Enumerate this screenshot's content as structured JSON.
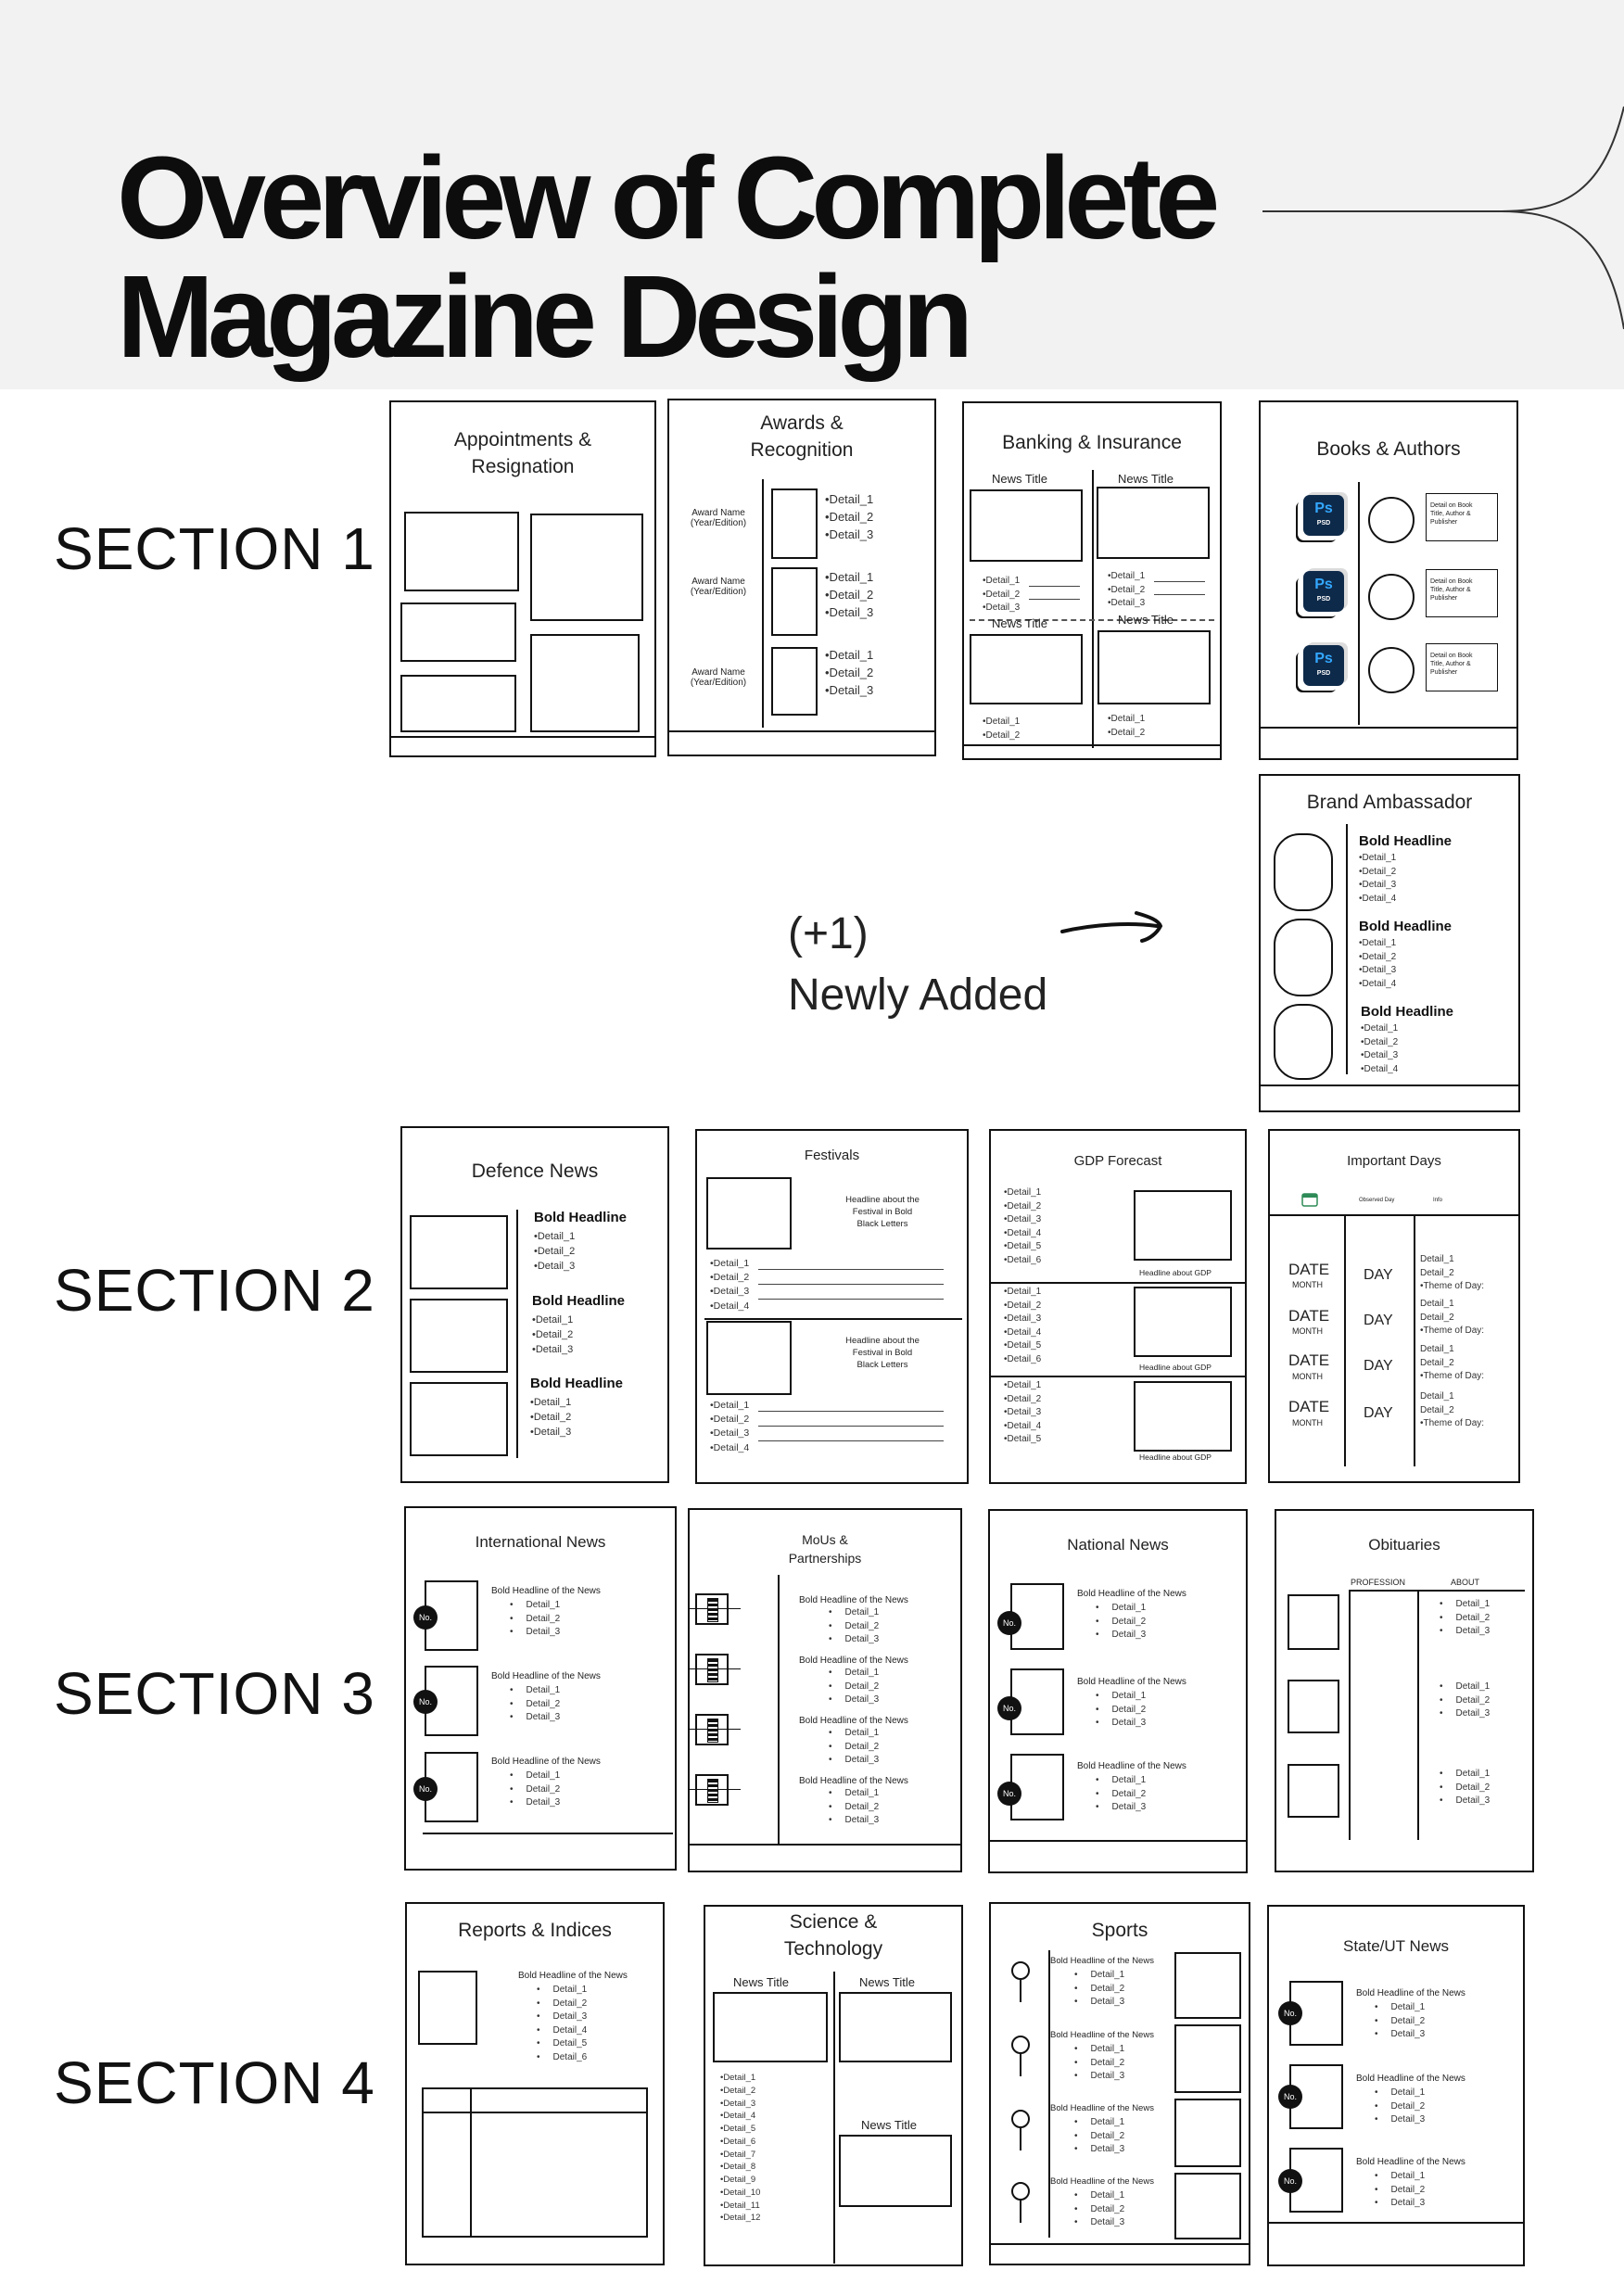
{
  "title": {
    "line1": "Overview of Complete",
    "line2": "Magazine Design"
  },
  "sections": [
    "SECTION 1",
    "SECTION 2",
    "SECTION 3",
    "SECTION 4"
  ],
  "note": {
    "count": "(+1)",
    "label": "Newly Added"
  },
  "detail3": [
    "•Detail_1",
    "•Detail_2",
    "•Detail_3"
  ],
  "detail4": [
    "•Detail_1",
    "•Detail_2",
    "•Detail_3",
    "•Detail_4"
  ],
  "detail2": [
    "•Detail_1",
    "•Detail_2"
  ],
  "plain3": [
    "Detail_1",
    "Detail_2",
    "Detail_3"
  ],
  "s1": {
    "appointments": {
      "title": "Appointments &\nResignation"
    },
    "awards": {
      "title": "Awards &\nRecognition",
      "award_label": "Award Name\n(Year/Edition)"
    },
    "banking": {
      "title": "Banking & Insurance",
      "news_title": "News Title",
      "list3": [
        "•Detail_1",
        "•Detail_2",
        "•Detail_3"
      ],
      "list2": [
        "•Detail_1",
        "•Detail_2"
      ]
    },
    "books": {
      "title": "Books & Authors",
      "ps": "Ps",
      "psd": "PSD",
      "caption": "Detail on Book\nTitle, Author &\nPublisher"
    },
    "brand": {
      "title": "Brand Ambassador",
      "headline": "Bold Headline"
    }
  },
  "s2": {
    "defence": {
      "title": "Defence News",
      "headline": "Bold Headline"
    },
    "festivals": {
      "title": "Festivals",
      "headline": "Headline about the\nFestival in Bold\nBlack Letters"
    },
    "gdp": {
      "title": "GDP Forecast",
      "headline": "Headline about GDP",
      "list6": [
        "•Detail_1",
        "•Detail_2",
        "•Detail_3",
        "•Detail_4",
        "•Detail_5",
        "•Detail_6"
      ],
      "list5": [
        "•Detail_1",
        "•Detail_2",
        "•Detail_3",
        "•Detail_4",
        "•Detail_5"
      ]
    },
    "days": {
      "title": "Important Days",
      "col_observed": "Observed Day",
      "col_info": "Info",
      "date": "DATE",
      "month": "MONTH",
      "day": "DAY",
      "details": [
        "Detail_1",
        "Detail_2",
        "•Theme of Day:"
      ]
    }
  },
  "s3": {
    "international": {
      "title": "International News",
      "headline": "Bold Headline of the News",
      "no": "No."
    },
    "mous": {
      "title": "MoUs &\nPartnerships",
      "headline": "Bold Headline of the News"
    },
    "national": {
      "title": "National News",
      "headline": "Bold Headline of the News",
      "no": "No."
    },
    "obituaries": {
      "title": "Obituaries",
      "col_profession": "PROFESSION",
      "col_about": "ABOUT"
    }
  },
  "s4": {
    "reports": {
      "title": "Reports & Indices",
      "headline": "Bold Headline of the News",
      "list6": [
        "Detail_1",
        "Detail_2",
        "Detail_3",
        "Detail_4",
        "Detail_5",
        "Detail_6"
      ]
    },
    "science": {
      "title": "Science &\nTechnology",
      "news_title": "News Title",
      "list12": [
        "•Detail_1",
        "•Detail_2",
        "•Detail_3",
        "•Detail_4",
        "•Detail_5",
        "•Detail_6",
        "•Detail_7",
        "•Detail_8",
        "•Detail_9",
        "•Detail_10",
        "•Detail_11",
        "•Detail_12"
      ]
    },
    "sports": {
      "title": "Sports",
      "headline": "Bold Headline of the News"
    },
    "state": {
      "title": "State/UT News",
      "headline": "Bold Headline of the News",
      "no": "No."
    }
  }
}
